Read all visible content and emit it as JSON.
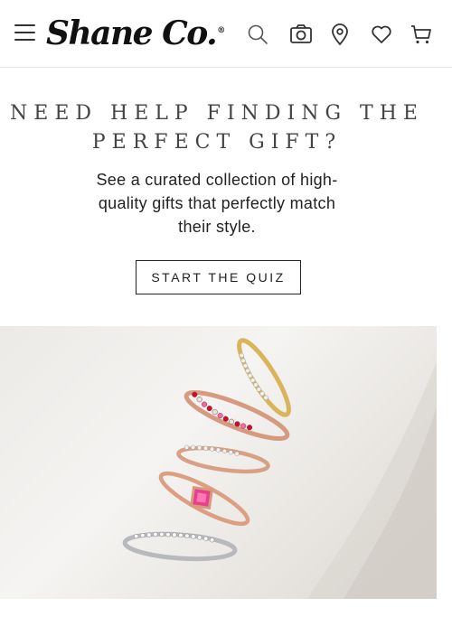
{
  "header": {
    "logo_text": "Shane Co.",
    "logo_mark": "®",
    "icons": [
      "menu-icon",
      "search-icon",
      "camera-icon",
      "location-pin-icon",
      "heart-icon",
      "cart-icon"
    ]
  },
  "promo": {
    "title": "NEED HELP FINDING THE PERFECT GIFT?",
    "description": "See a curated collection of high-quality gifts that perfectly match their style.",
    "cta_label": "START THE QUIZ"
  },
  "hero": {
    "subject": "stacked rings on marble"
  },
  "colors": {
    "accent_dark": "#222222",
    "title_gray": "#444444",
    "divider": "#e4e4e4"
  }
}
